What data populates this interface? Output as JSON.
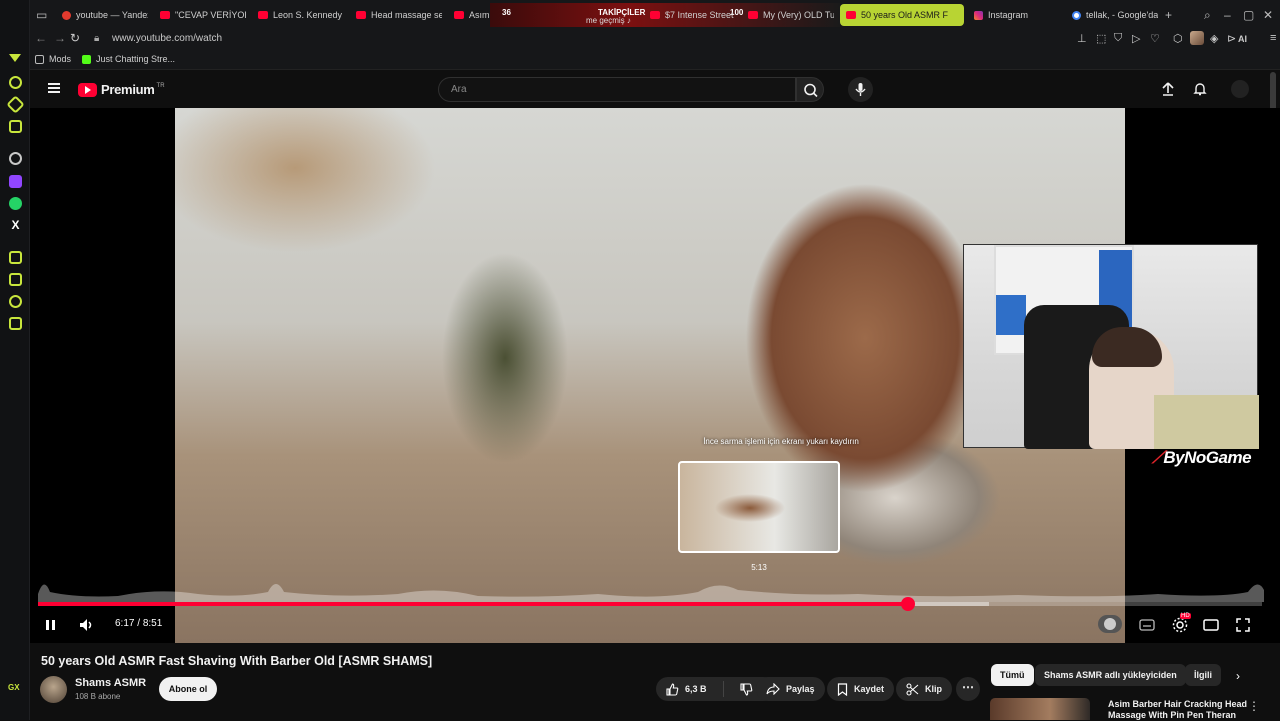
{
  "browser": {
    "tabs": [
      {
        "label": "youtube — Yandex",
        "icon": "yandex-icon"
      },
      {
        "label": "\"CEVAP VERİYOR",
        "icon": "youtube-icon"
      },
      {
        "label": "Leon S. Kennedy",
        "icon": "youtube-icon"
      },
      {
        "label": "Head massage se",
        "icon": "youtube-icon"
      },
      {
        "label": "Asım",
        "icon": "youtube-icon"
      },
      {
        "label": "me geçmiş ♪",
        "icon": "youtube-icon"
      },
      {
        "label": "$7 Intense Street",
        "icon": "youtube-icon"
      },
      {
        "label": "My (Very) OLD Tu",
        "icon": "youtube-icon"
      },
      {
        "label": "50 years Old ASMR F",
        "icon": "youtube-icon"
      },
      {
        "label": "Instagram",
        "icon": "instagram-icon"
      },
      {
        "label": "tellak, - Google'da",
        "icon": "google-icon"
      }
    ],
    "stream_overlay": {
      "count": "36",
      "label": "TAKİPÇİLER",
      "count2": "100"
    },
    "url": "www.youtube.com/watch",
    "ai_label": "AI",
    "bookmarks": [
      {
        "label": "Mods",
        "icon": "mods-icon"
      },
      {
        "label": "Just Chatting Stre...",
        "icon": "kick-icon"
      }
    ],
    "gx_label": "GX"
  },
  "youtube": {
    "logo_text": "Premium",
    "region": "TR",
    "search_placeholder": "Ara"
  },
  "player": {
    "scrub_hint": "İnce sarma işlemi için ekranı yukarı kaydırın",
    "preview_time": "5:13",
    "current_time": "6:17",
    "duration": "8:51",
    "time_separator": " / ",
    "progress_played": 0.7109,
    "progress_buffered": 0.777,
    "watermark": "ByNoGame",
    "hd_badge": "HD"
  },
  "video": {
    "title": "50 years Old ASMR Fast Shaving With Barber Old [ASMR SHAMS]",
    "channel": "Shams ASMR",
    "subscribers": "108 B abone",
    "subscribe_label": "Abone ol",
    "likes": "6,3 B",
    "share_label": "Paylaş",
    "save_label": "Kaydet",
    "clip_label": "Klip"
  },
  "sidebar": {
    "chips": [
      "Tümü",
      "Shams ASMR adlı yükleyiciden",
      "İlgili"
    ],
    "recommended": [
      {
        "title": "Asim Barber Hair Cracking Head Massage With Pin Pen Theran"
      }
    ]
  }
}
